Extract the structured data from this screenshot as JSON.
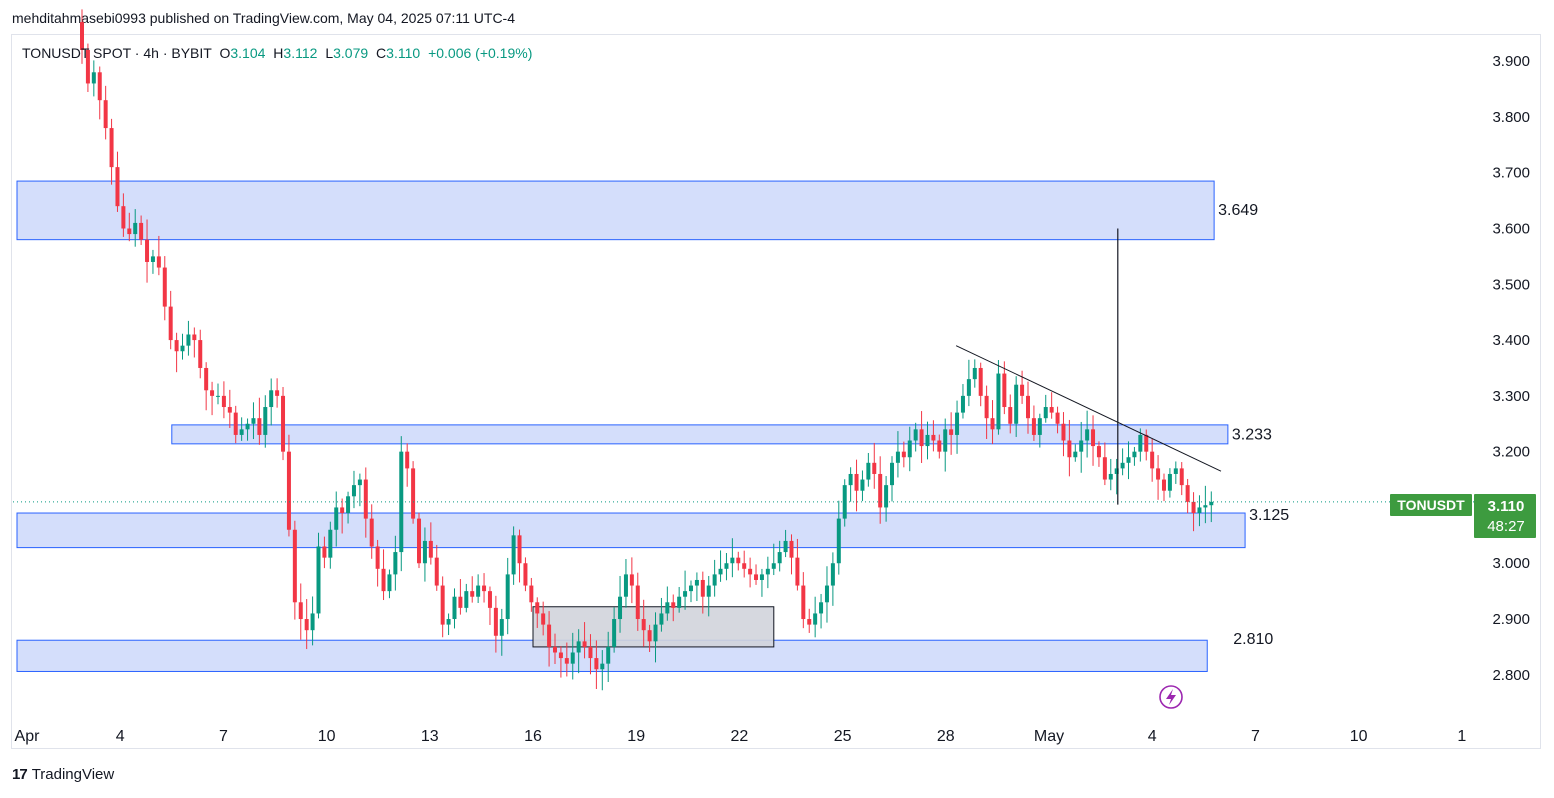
{
  "header": {
    "publisher_line": "mehditahmasebi0993 published on TradingView.com, May 04, 2025 07:11 UTC-4"
  },
  "legend": {
    "symbol_text": "TONUSDT SPOT · 4h · BYBIT",
    "open_label": "O",
    "open_value": "3.104",
    "high_label": "H",
    "high_value": "3.112",
    "low_label": "L",
    "low_value": "3.079",
    "close_label": "C",
    "close_value": "3.110",
    "change_text": "+0.006 (+0.19%)"
  },
  "price_tag": {
    "symbol": "TONUSDT",
    "price": "3.110",
    "countdown": "48:27"
  },
  "footer": {
    "brand": "TradingView",
    "logo_mark": "17"
  },
  "colors": {
    "up": "#089981",
    "down": "#f23645",
    "zone_fill": "#d4defb",
    "zone_stroke": "#2962ff",
    "box_fill": "#d1d4dc",
    "tag_bg": "#3d9b3f"
  },
  "icons": {
    "lightning": "lightning-icon"
  },
  "chart_data": {
    "type": "candlestick",
    "symbol": "TONUSDT",
    "timeframe": "4h",
    "y_axis": {
      "range": [
        2.745,
        3.98
      ],
      "ticks": [
        "3.900",
        "3.800",
        "3.700",
        "3.600",
        "3.500",
        "3.400",
        "3.300",
        "3.200",
        "3.100",
        "3.000",
        "2.900",
        "2.800"
      ]
    },
    "x_axis": {
      "labels": [
        "Apr",
        "4",
        "7",
        "10",
        "13",
        "16",
        "19",
        "22",
        "25",
        "28",
        "May",
        "4",
        "7",
        "10",
        "1"
      ],
      "start_date": "2025-04-01"
    },
    "zones": [
      {
        "name": "upper-resistance",
        "low": 3.58,
        "high": 3.685,
        "from_day": 0,
        "to_day": 34.8,
        "label": "3.649"
      },
      {
        "name": "mid-resistance",
        "low": 3.214,
        "high": 3.248,
        "from_day": 4.5,
        "to_day": 35.2,
        "label": "3.233"
      },
      {
        "name": "current-support",
        "low": 3.028,
        "high": 3.09,
        "from_day": 0,
        "to_day": 35.7,
        "label": "3.125"
      },
      {
        "name": "lower-support",
        "low": 2.806,
        "high": 2.862,
        "from_day": 0,
        "to_day": 34.6,
        "label": "2.810"
      }
    ],
    "consolidation_box": {
      "low": 2.85,
      "high": 2.922,
      "from_day": 15.0,
      "to_day": 22.0
    },
    "trendline": {
      "from": {
        "day": 27.3,
        "price": 3.39
      },
      "to": {
        "day": 35.0,
        "price": 3.165
      }
    },
    "target_line": {
      "day": 32.0,
      "from_price": 3.105,
      "to_price": 3.6
    },
    "current_price": 3.11,
    "closes": [
      3.97,
      3.92,
      3.86,
      3.88,
      3.83,
      3.78,
      3.71,
      3.64,
      3.6,
      3.59,
      3.61,
      3.58,
      3.54,
      3.55,
      3.53,
      3.46,
      3.4,
      3.38,
      3.39,
      3.41,
      3.4,
      3.35,
      3.31,
      3.3,
      3.3,
      3.28,
      3.27,
      3.23,
      3.24,
      3.25,
      3.26,
      3.23,
      3.28,
      3.31,
      3.3,
      3.2,
      3.06,
      2.93,
      2.9,
      2.88,
      2.91,
      3.03,
      3.01,
      3.06,
      3.1,
      3.09,
      3.12,
      3.14,
      3.15,
      3.08,
      3.03,
      2.99,
      2.95,
      2.98,
      3.02,
      3.2,
      3.17,
      3.08,
      3.0,
      3.04,
      3.01,
      2.96,
      2.89,
      2.9,
      2.94,
      2.92,
      2.95,
      2.94,
      2.96,
      2.95,
      2.92,
      2.87,
      2.9,
      2.98,
      3.05,
      3.0,
      2.96,
      2.93,
      2.91,
      2.89,
      2.85,
      2.84,
      2.83,
      2.82,
      2.84,
      2.86,
      2.85,
      2.83,
      2.81,
      2.82,
      2.85,
      2.9,
      2.94,
      2.98,
      2.96,
      2.9,
      2.88,
      2.86,
      2.89,
      2.91,
      2.93,
      2.92,
      2.94,
      2.95,
      2.96,
      2.97,
      2.94,
      2.96,
      2.98,
      2.99,
      3.0,
      3.01,
      3.0,
      2.99,
      2.98,
      2.97,
      2.98,
      2.99,
      3.0,
      3.02,
      3.04,
      3.01,
      2.96,
      2.9,
      2.89,
      2.91,
      2.93,
      2.96,
      3.0,
      3.08,
      3.14,
      3.16,
      3.13,
      3.15,
      3.18,
      3.16,
      3.1,
      3.14,
      3.18,
      3.2,
      3.19,
      3.22,
      3.24,
      3.21,
      3.23,
      3.22,
      3.2,
      3.24,
      3.23,
      3.27,
      3.3,
      3.33,
      3.35,
      3.3,
      3.26,
      3.24,
      3.34,
      3.28,
      3.25,
      3.32,
      3.3,
      3.26,
      3.23,
      3.26,
      3.28,
      3.27,
      3.25,
      3.22,
      3.19,
      3.2,
      3.22,
      3.24,
      3.21,
      3.19,
      3.15,
      3.16,
      3.17,
      3.18,
      3.19,
      3.2,
      3.23,
      3.2,
      3.17,
      3.15,
      3.13,
      3.16,
      3.17,
      3.14,
      3.11,
      3.09,
      3.1,
      3.104,
      3.11
    ]
  }
}
